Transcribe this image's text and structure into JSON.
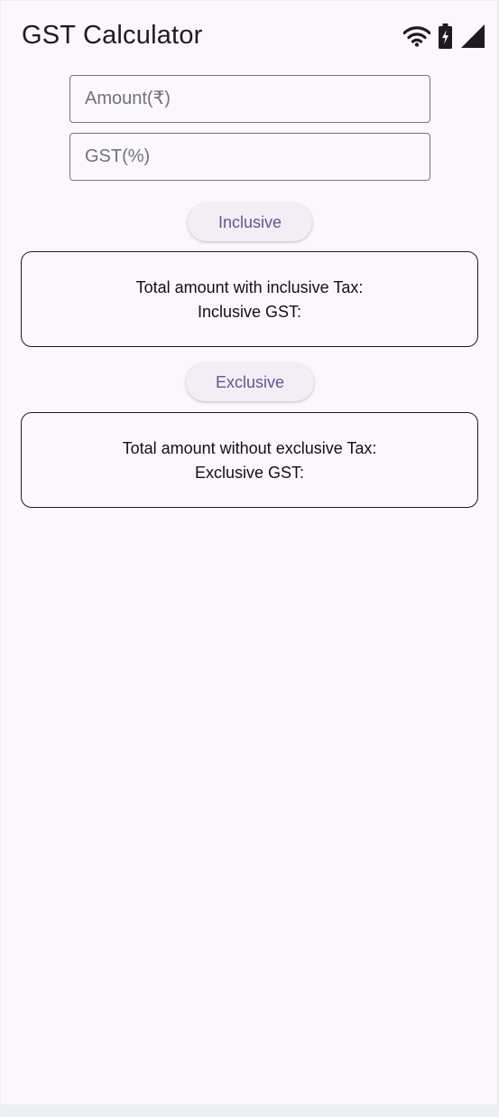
{
  "appbar": {
    "title": "GST Calculator"
  },
  "status_icons": [
    "wifi-icon",
    "battery-charging-icon",
    "cellular-signal-icon"
  ],
  "inputs": {
    "amount": {
      "placeholder": "Amount(₹)",
      "value": ""
    },
    "gst": {
      "placeholder": "GST(%)",
      "value": ""
    }
  },
  "inclusive": {
    "button_label": "Inclusive",
    "total_label": "Total amount with inclusive Tax:",
    "gst_label": "Inclusive GST:"
  },
  "exclusive": {
    "button_label": "Exclusive",
    "total_label": "Total amount without exclusive Tax:",
    "gst_label": "Exclusive GST:"
  },
  "colors": {
    "background": "#fcf7fc",
    "button_bg": "#f3edf6",
    "button_text": "#66558f",
    "outline": "#79747e"
  }
}
